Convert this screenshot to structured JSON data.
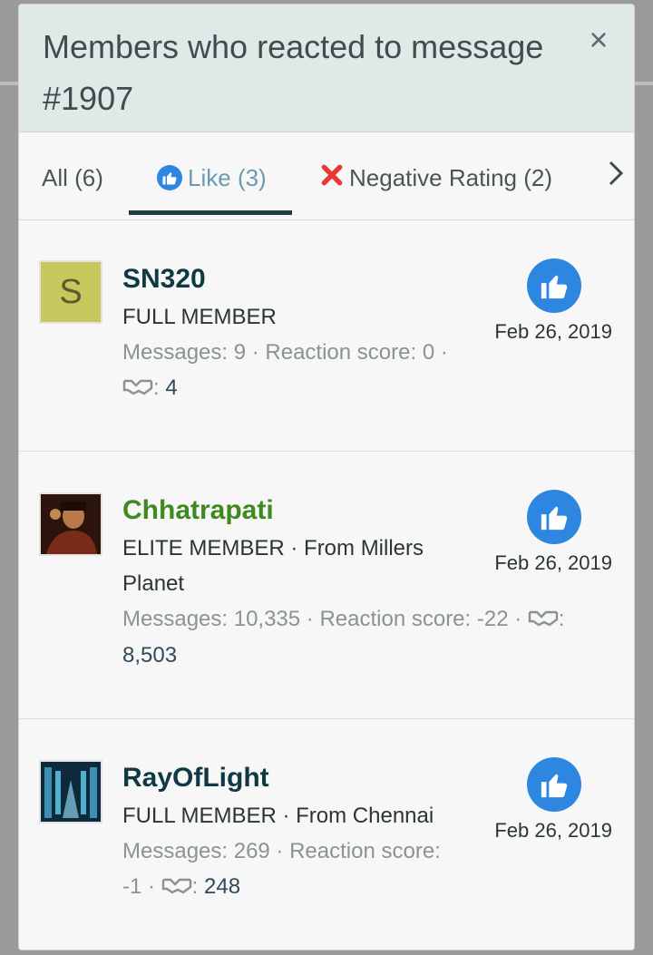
{
  "dialog": {
    "title": "Members who reacted to message #1907",
    "close_glyph": "×"
  },
  "tabs": [
    {
      "label": "All",
      "count": "(6)"
    },
    {
      "label": "Like",
      "count": "(3)"
    },
    {
      "label": "Negative Rating",
      "count": "(2)"
    }
  ],
  "members": [
    {
      "name": "SN320",
      "name_color": "#0f3a45",
      "avatar_letter": "S",
      "meta_lines": [
        "FULL MEMBER"
      ],
      "stats_lines": [
        {
          "prefix": "Messages: ",
          "messages": "9",
          "mid": " · Reaction score: ",
          "score": "0",
          "suffix": " ·"
        },
        {
          "hs_value": "4"
        }
      ],
      "date": "Feb 26, 2019"
    },
    {
      "name": "Chhatrapati",
      "name_color": "#3f8a1f",
      "meta_lines": [
        "ELITE MEMBER · From Millers",
        "Planet"
      ],
      "stats_lines": [
        {
          "prefix": "Messages: ",
          "messages": "10,335",
          "mid": " · Reaction score: ",
          "score": "-22",
          "suffix": " ·"
        },
        {
          "value_only": "8,503"
        }
      ],
      "date": "Feb 26, 2019"
    },
    {
      "name": "RayOfLight",
      "name_color": "#0f3a45",
      "meta_lines": [
        "FULL MEMBER · From Chennai"
      ],
      "stats_lines": [
        {
          "prefix": "Messages: ",
          "messages": "269",
          "mid": " · Reaction score:"
        },
        {
          "score2": "-1",
          "hs_value": "248"
        }
      ],
      "date": "Feb 26, 2019"
    }
  ],
  "colors": {
    "header_bg": "#dfe9e8",
    "like_blue": "#2d86e0",
    "negative_red": "#e53935",
    "tab_underline": "#1f3f43"
  }
}
